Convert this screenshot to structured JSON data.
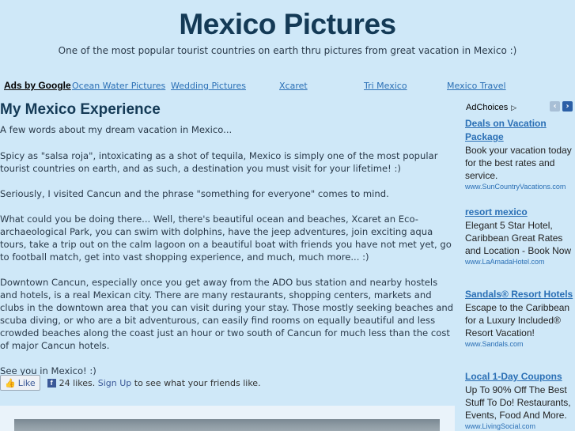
{
  "header": {
    "title": "Mexico Pictures",
    "tagline": "One of the most popular tourist countries on earth thru pictures from great vacation in Mexico :)"
  },
  "adbar": {
    "ads_by": "Ads by Google",
    "links": [
      "Ocean Water Pictures",
      "Wedding Pictures",
      "Xcaret",
      "Tri Mexico",
      "Mexico Travel"
    ]
  },
  "main": {
    "heading": "My Mexico Experience",
    "paragraphs": [
      "A few words about my dream vacation in Mexico...",
      "Spicy as \"salsa roja\", intoxicating as a shot of tequila, Mexico is simply one of the most popular tourist countries on earth, and as such, a destination you must visit for your lifetime! :)",
      "Seriously, I visited Cancun and the phrase \"something for everyone\" comes to mind.",
      "What could you be doing there... Well, there's beautiful ocean and beaches, Xcaret an Eco-archaeological Park, you can swim with dolphins, have the jeep adventures, join exciting aqua tours, take a trip out on the calm lagoon on a beautiful boat with friends you have not met yet, go to football match, get into vast shopping experience, and much, much more... :)",
      "Downtown Cancun, especially once you get away from the ADO bus station and nearby hostels and hotels, is a real Mexican city. There are many restaurants, shopping centers, markets and clubs in the downtown area that you can visit during your stay. Those mostly seeking beaches and scuba diving, or who are a bit adventurous, can easily find rooms on equally beautiful and less crowded beaches along the coast just an hour or two south of Cancun for much less than the cost of major Cancun hotels.",
      "See you in Mexico! :)"
    ]
  },
  "social": {
    "like_label": "Like",
    "likes_text": "24 likes.",
    "signup_text": "Sign Up",
    "signup_suffix": "to see what your friends like."
  },
  "sidebar": {
    "adchoices": "AdChoices",
    "ads": [
      {
        "title": "Deals on Vacation Package",
        "body": "Book your vacation today for the best rates and service.",
        "url": "www.SunCountryVacations.com"
      },
      {
        "title": "resort mexico",
        "body": "Elegant 5 Star Hotel, Caribbean Great Rates and Location - Book Now",
        "url": "www.LaAmadaHotel.com"
      },
      {
        "title": "Sandals® Resort Hotels",
        "body": "Escape to the Caribbean for a Luxury Included® Resort Vacation!",
        "url": "www.Sandals.com"
      },
      {
        "title": "Local 1-Day Coupons",
        "body": "Up To 90% Off The Best Stuff To Do! Restaurants, Events, Food And More.",
        "url": "www.LivingSocial.com"
      }
    ]
  },
  "colors": {
    "background": "#cfe8f8",
    "title": "#143a56",
    "link": "#2a6fb5",
    "facebook": "#3b5998"
  }
}
